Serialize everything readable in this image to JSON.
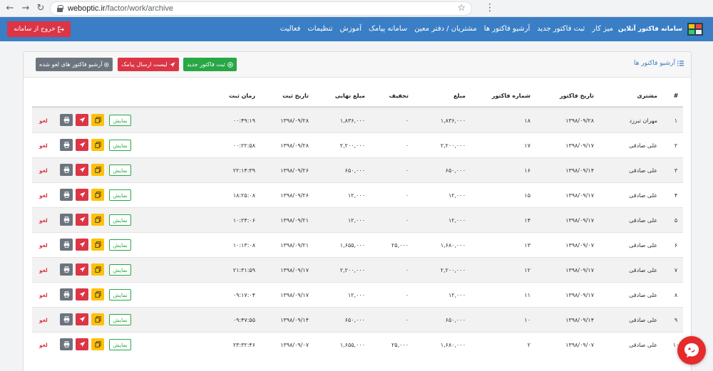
{
  "browser": {
    "url_domain": "weboptic.ir",
    "url_path": "/factor/work/archive",
    "back_icon": "arrow-left-icon",
    "forward_icon": "arrow-right-icon",
    "reload_icon": "reload-icon"
  },
  "navbar": {
    "brand": "سامانه فاکتور آنلاین",
    "items": [
      "میز کار",
      "ثبت فاکتور جدید",
      "آرشیو فاکتور ها",
      "مشتریان / دفتر معین",
      "سامانه پیامک",
      "آموزش",
      "تنظیمات",
      "فعالیت"
    ],
    "logout": "خروج از سامانه",
    "color": "#3a7ec5"
  },
  "page": {
    "title": "آرشیو فاکتور ها",
    "new_invoice": "ثبت فاکتور جدید",
    "sms_list": "لیست ارسال پیامک",
    "canceled_archive": "آرشیو فاکتور های لغو شده"
  },
  "table": {
    "headers": [
      "#",
      "مشتری",
      "تاریخ فاکتور",
      "شماره فاکتور",
      "مبلغ",
      "تخفیف",
      "مبلغ نهایی",
      "تاریخ ثبت",
      "زمان ثبت"
    ],
    "show_label": "نمایش",
    "cancel_label": "لغو",
    "rows": [
      {
        "n": "۱",
        "customer": "مهران تبرزد",
        "date": "۱۳۹۸/۰۹/۲۸",
        "number": "۱۸",
        "amount": "۱,۸۳۶,۰۰۰",
        "discount": "۰",
        "final": "۱,۸۳۶,۰۰۰",
        "reg_date": "۱۳۹۸/۰۹/۲۸",
        "reg_time": "۰۰:۴۹:۱۹"
      },
      {
        "n": "۲",
        "customer": "علی صادقی",
        "date": "۱۳۹۸/۰۹/۱۷",
        "number": "۱۷",
        "amount": "۲,۲۰۰,۰۰۰",
        "discount": "۰",
        "final": "۲,۲۰۰,۰۰۰",
        "reg_date": "۱۳۹۸/۰۹/۲۸",
        "reg_time": "۰۰:۲۲:۵۸"
      },
      {
        "n": "۳",
        "customer": "علی صادقی",
        "date": "۱۳۹۸/۰۹/۱۴",
        "number": "۱۶",
        "amount": "۶۵۰,۰۰۰",
        "discount": "۰",
        "final": "۶۵۰,۰۰۰",
        "reg_date": "۱۳۹۸/۰۹/۲۶",
        "reg_time": "۲۲:۱۴:۳۹"
      },
      {
        "n": "۴",
        "customer": "علی صادقی",
        "date": "۱۳۹۸/۰۹/۱۷",
        "number": "۱۵",
        "amount": "۱۲,۰۰۰",
        "discount": "۰",
        "final": "۱۲,۰۰۰",
        "reg_date": "۱۳۹۸/۰۹/۲۶",
        "reg_time": "۱۸:۲۵:۰۸"
      },
      {
        "n": "۵",
        "customer": "علی صادقی",
        "date": "۱۳۹۸/۰۹/۱۷",
        "number": "۱۴",
        "amount": "۱۲,۰۰۰",
        "discount": "۰",
        "final": "۱۲,۰۰۰",
        "reg_date": "۱۳۹۸/۰۹/۲۱",
        "reg_time": "۱۰:۲۴:۰۶"
      },
      {
        "n": "۶",
        "customer": "علی صادقی",
        "date": "۱۳۹۸/۰۹/۰۷",
        "number": "۱۳",
        "amount": "۱,۶۸۰,۰۰۰",
        "discount": "۲۵,۰۰۰",
        "final": "۱,۶۵۵,۰۰۰",
        "reg_date": "۱۳۹۸/۰۹/۲۱",
        "reg_time": "۱۰:۱۳:۰۸"
      },
      {
        "n": "۷",
        "customer": "علی صادقی",
        "date": "۱۳۹۸/۰۹/۱۷",
        "number": "۱۲",
        "amount": "۲,۲۰۰,۰۰۰",
        "discount": "۰",
        "final": "۲,۲۰۰,۰۰۰",
        "reg_date": "۱۳۹۸/۰۹/۱۷",
        "reg_time": "۲۱:۳۱:۵۹"
      },
      {
        "n": "۸",
        "customer": "علی صادقی",
        "date": "۱۳۹۸/۰۹/۱۷",
        "number": "۱۱",
        "amount": "۱۲,۰۰۰",
        "discount": "۰",
        "final": "۱۲,۰۰۰",
        "reg_date": "۱۳۹۸/۰۹/۱۷",
        "reg_time": "۰۹:۱۷:۰۴"
      },
      {
        "n": "۹",
        "customer": "علی صادقی",
        "date": "۱۳۹۸/۰۹/۱۴",
        "number": "۱۰",
        "amount": "۶۵۰,۰۰۰",
        "discount": "۰",
        "final": "۶۵۰,۰۰۰",
        "reg_date": "۱۳۹۸/۰۹/۱۴",
        "reg_time": "۰۹:۴۷:۵۵"
      },
      {
        "n": "۱۰",
        "customer": "علی صادقی",
        "date": "۱۳۹۸/۰۹/۰۷",
        "number": "۲",
        "amount": "۱,۶۸۰,۰۰۰",
        "discount": "۲۵,۰۰۰",
        "final": "۱,۶۵۵,۰۰۰",
        "reg_date": "۱۳۹۸/۰۹/۰۷",
        "reg_time": "۲۳:۳۲:۴۶"
      }
    ]
  },
  "colors": {
    "success": "#28a745",
    "danger": "#dc3545",
    "warning": "#ffc107",
    "secondary": "#6c757d"
  },
  "icons": [
    "print-icon",
    "send-icon",
    "copy-icon",
    "logout-icon",
    "list-icon",
    "plus-circle-icon",
    "times-circle-icon",
    "chat-icon",
    "star-icon",
    "lock-icon",
    "more-icon",
    "logo-icon"
  ]
}
